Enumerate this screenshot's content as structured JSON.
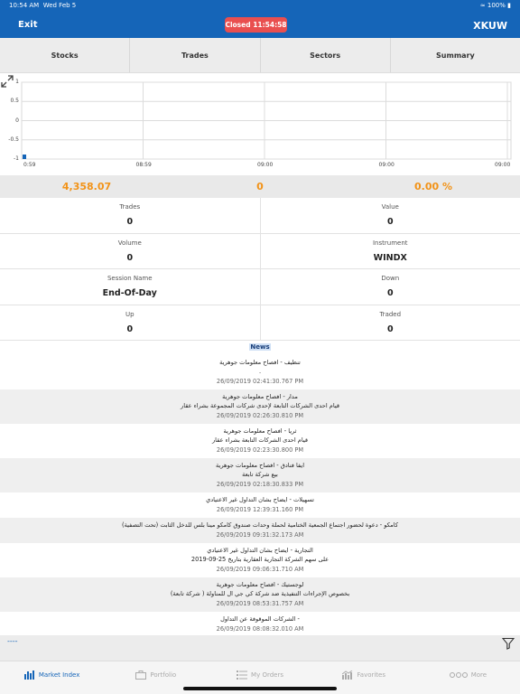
{
  "status_bar": {
    "time": "10:54 AM",
    "date": "Wed Feb 5",
    "battery": "100%"
  },
  "header": {
    "exit_label": "Exit",
    "market_status": "Closed  11:54:58",
    "index_name": "XKUW"
  },
  "tabs": [
    {
      "label": "Stocks"
    },
    {
      "label": "Trades"
    },
    {
      "label": "Sectors"
    },
    {
      "label": "Summary"
    }
  ],
  "chart_data": {
    "type": "line",
    "y_ticks": [
      "1",
      "0.5",
      "0",
      "-0.5",
      "-1"
    ],
    "x_ticks": [
      "0:59",
      "08:59",
      "09:00",
      "09:00",
      "09:00"
    ],
    "ylim": [
      -1,
      1
    ],
    "grid": true,
    "series": [
      {
        "x": [
          "0:59"
        ],
        "values": [
          -1
        ]
      }
    ]
  },
  "summary": {
    "index_value": "4,358.07",
    "change": "0",
    "change_percent": "0.00 %"
  },
  "stats": [
    [
      {
        "label": "Trades",
        "value": "0"
      },
      {
        "label": "Value",
        "value": "0"
      }
    ],
    [
      {
        "label": "Volume",
        "value": "0"
      },
      {
        "label": "Instrument",
        "value": "WINDX"
      }
    ],
    [
      {
        "label": "Session Name",
        "value": "End-Of-Day"
      },
      {
        "label": "Down",
        "value": "0"
      }
    ],
    [
      {
        "label": "Up",
        "value": "0"
      },
      {
        "label": "Traded",
        "value": "0"
      }
    ]
  ],
  "news_title": "News",
  "news": [
    {
      "lines": [
        "تنظيف - افصاح معلومات جوهرية",
        "."
      ],
      "date": "26/09/2019 02:41:30.767 PM"
    },
    {
      "lines": [
        "مدار - افصاح معلومات جوهرية",
        "قيام احدى الشركات التابعة لإحدى شركات المجموعة بشراء عقار"
      ],
      "date": "26/09/2019 02:26:30.810 PM"
    },
    {
      "lines": [
        "ثريا - افصاح معلومات جوهرية",
        "قيام احدى الشركات التابعة بشراء عقار"
      ],
      "date": "26/09/2019 02:23:30.800 PM"
    },
    {
      "lines": [
        "ايفا فنادق - افصاح معلومات جوهرية",
        "بيع شركة تابعة"
      ],
      "date": "26/09/2019 02:18:30.833 PM"
    },
    {
      "lines": [
        "تسهيلات - ايضاح بشان التداول غير الاعتيادي"
      ],
      "date": "26/09/2019 12:39:31.160 PM"
    },
    {
      "lines": [
        "كامكو  -  دعوة لحضور اجتماع الجمعية الختامية لحملة وحدات صندوق كامكو مينا بلس للدخل الثابت (تحت التصفية)"
      ],
      "date": "26/09/2019 09:31:32.173 AM"
    },
    {
      "lines": [
        "التجارية - ايضاح بشان التداول غير الاعتيادي",
        "على سهم الشركة التجارية العقارية بتاريخ 25-09-2019"
      ],
      "date": "26/09/2019 09:06:31.710 AM"
    },
    {
      "lines": [
        "لوجستيك - افصاح معلومات جوهرية",
        "بخصوص الإجراءات التنفيذية ضد شركة كي جي ال للمناولة ( شركة تابعة)"
      ],
      "date": "26/09/2019 08:53:31.757 AM"
    },
    {
      "lines": [
        "- الشركات الموقوفة عن التداول"
      ],
      "date": "26/09/2019 08:08:32.010 AM"
    }
  ],
  "filter_bar": {
    "dash": "----"
  },
  "bottom_nav": [
    {
      "label": "Market Index",
      "icon": "bar-chart-icon",
      "active": true
    },
    {
      "label": "Portfolio",
      "icon": "briefcase-icon",
      "active": false
    },
    {
      "label": "My Orders",
      "icon": "list-icon",
      "active": false
    },
    {
      "label": "Favorites",
      "icon": "favorites-chart-icon",
      "active": false
    },
    {
      "label": "More",
      "icon": "more-dots-icon",
      "active": false
    }
  ],
  "colors": {
    "header": "#1565b8",
    "accent": "#f29318",
    "closed_badge": "#e94f4f"
  }
}
